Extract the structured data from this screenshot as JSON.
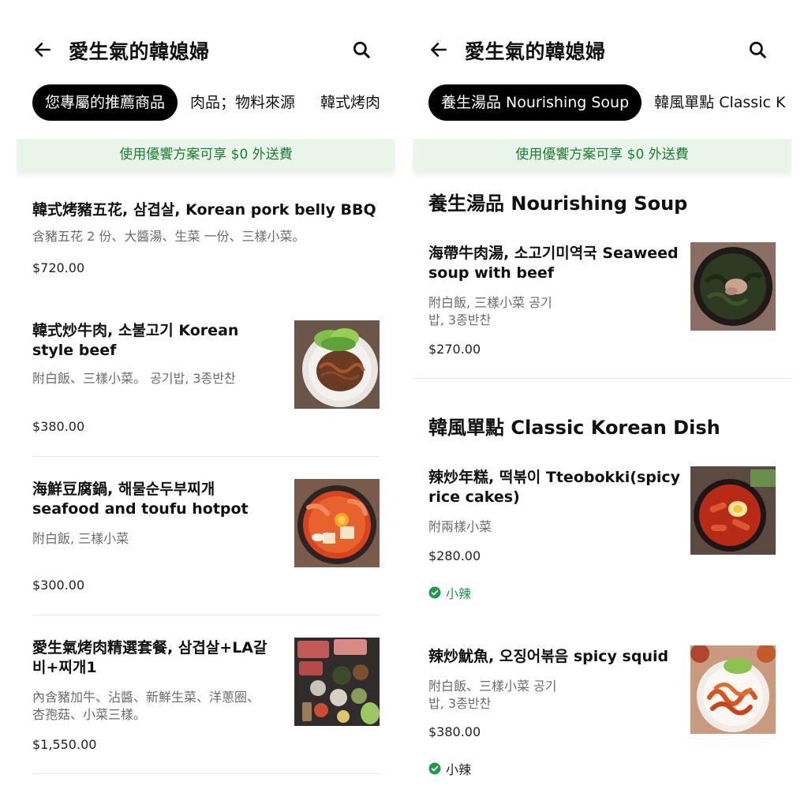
{
  "store_title": "愛生氣的韓媳婦",
  "left": {
    "tabs": [
      "您專屬的推薦商品",
      "肉品；物料來源",
      "韓式烤肉"
    ],
    "promo": "使用優饗方案可享 $0 外送費",
    "items": [
      {
        "name": "韓式烤豬五花, 삼겹살, Korean pork belly BBQ",
        "desc": "含豬五花 2 份、大醬湯、生菜 一份、三樣小菜。",
        "price": "$720.00"
      },
      {
        "name": "韓式炒牛肉, 소불고기 Korean style beef",
        "desc": "附白飯、三樣小菜。 공기밥, 3종반찬",
        "price": "$380.00",
        "image": "bulgogi-plate"
      },
      {
        "name": "海鮮豆腐鍋, 해물순두부찌개 seafood and toufu hotpot",
        "desc": "附白飯, 三樣小菜",
        "price": "$300.00",
        "image": "seafood-tofu-hotpot"
      },
      {
        "name": "愛生氣烤肉精選套餐, 삼겹살+LA갈비+찌개1",
        "desc": "內含豬加牛、沾醬、新鮮生菜、洋蔥圈、杏孢菇、小菜三樣。",
        "price": "$1,550.00",
        "image": "bbq-set-spread"
      }
    ]
  },
  "right": {
    "tabs": [
      "養生湯品 Nourishing Soup",
      "韓風單點 Classic K"
    ],
    "promo": "使用優饗方案可享 $0 外送費",
    "sections": [
      {
        "title": "養生湯品 Nourishing Soup",
        "items": [
          {
            "name": "海帶牛肉湯, 소고기미역국 Seaweed soup with beef",
            "desc": "附白飯, 三樣小菜 공기밥, 3종반찬",
            "price": "$270.00",
            "image": "seaweed-soup-pot"
          }
        ]
      },
      {
        "title": "韓風單點 Classic Korean Dish",
        "items": [
          {
            "name": "辣炒年糕, 떡볶이 Tteobokki(spicy rice cakes)",
            "desc": "附兩樣小菜",
            "price": "$280.00",
            "badge": "小辣",
            "image": "tteokbokki-pan"
          },
          {
            "name": "辣炒魷魚, 오징어볶음 spicy squid",
            "desc": "附白飯、三樣小菜 공기밥, 3종반찬",
            "price": "$380.00",
            "badge": "小辣",
            "image": "spicy-squid-plate"
          }
        ]
      }
    ]
  },
  "colors": {
    "accent_green": "#1e9a4a",
    "promo_bg": "#eaf5e9",
    "promo_text": "#1e7d38",
    "tab_active_bg": "#000000"
  },
  "icons": [
    "back-arrow-icon",
    "search-icon",
    "check-badge-icon"
  ]
}
